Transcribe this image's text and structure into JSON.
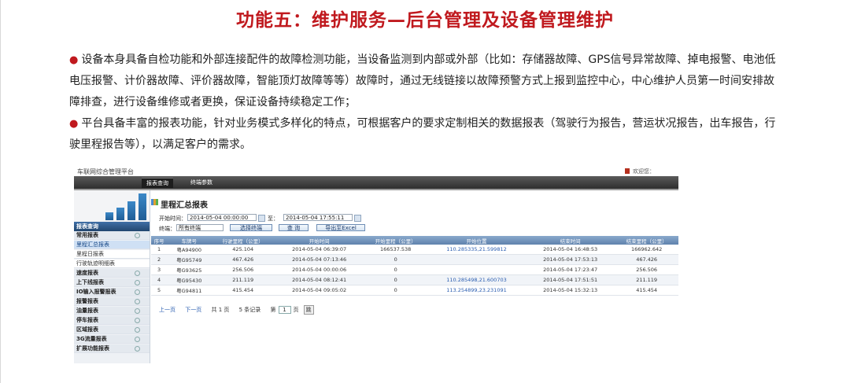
{
  "slide": {
    "title": "功能五：维护服务—后台管理及设备管理维护",
    "bullet_mark": "●",
    "bullets": [
      "设备本身具备自检功能和外部连接配件的故障检测功能，当设备监测到内部或外部（比如：存储器故障、GPS信号异常故障、掉电报警、电池低电压报警、计价器故障、评价器故障，智能顶灯故障等等）故障时，通过无线链接以故障预警方式上报到监控中心，中心维护人员第一时间安排故障排查，进行设备维修或者更换，保证设备持续稳定工作；",
      "平台具备丰富的报表功能，针对业务模式多样化的特点，可根据客户的要求定制相关的数据报表（驾驶行为报告，营运状况报告，出车报告，行驶里程报告等），以满足客户的需求。"
    ]
  },
  "app": {
    "title": "车联网综合管理平台",
    "user_text": "欢迎您：",
    "nav_tabs": [
      "报表查询",
      "终端参数"
    ],
    "sidebar": {
      "header": "报表查询",
      "items": [
        {
          "label": "常用报表",
          "kind": "group"
        },
        {
          "label": "里程汇总报表",
          "kind": "selected"
        },
        {
          "label": "里程日报表",
          "kind": "sub"
        },
        {
          "label": "行驶轨迹明细表",
          "kind": "sub"
        },
        {
          "label": "速度报表",
          "kind": "group"
        },
        {
          "label": "上下线报表",
          "kind": "group"
        },
        {
          "label": "IO输入报警报表",
          "kind": "group"
        },
        {
          "label": "报警报表",
          "kind": "group"
        },
        {
          "label": "油量报表",
          "kind": "group"
        },
        {
          "label": "停车报表",
          "kind": "group"
        },
        {
          "label": "区域报表",
          "kind": "group"
        },
        {
          "label": "3G流量报表",
          "kind": "group"
        },
        {
          "label": "扩展功能报表",
          "kind": "group"
        }
      ]
    },
    "report": {
      "title": "里程汇总报表",
      "start_label": "开始时间：",
      "start_value": "2014-05-04 00:00:00",
      "to_label": "至：",
      "end_value": "2014-05-04 17:55:11",
      "terminal_label": "终端：",
      "terminal_value": "所有终端",
      "select_btn": "选择终端",
      "query_btn": "查 询",
      "export_btn": "导出至Excel",
      "columns": [
        "序号",
        "车牌号",
        "行驶里程（公里）",
        "开始时间",
        "开始里程（公里）",
        "开始位置",
        "结束时间",
        "结束里程（公里）"
      ],
      "rows": [
        [
          "1",
          "粤A94900",
          "425.104",
          "2014-05-04 06:39:07",
          "166537.538",
          "110.285335,21.599812",
          "2014-05-04 16:48:53",
          "166962.642"
        ],
        [
          "2",
          "粤G95749",
          "467.426",
          "2014-05-04 07:13:46",
          "0",
          "",
          "2014-05-04 17:53:13",
          "467.426"
        ],
        [
          "3",
          "粤G93625",
          "256.506",
          "2014-05-04 00:00:06",
          "0",
          "",
          "2014-05-04 17:23:47",
          "256.506"
        ],
        [
          "4",
          "粤G95430",
          "211.119",
          "2014-05-04 08:12:41",
          "0",
          "110.285498,21.600703",
          "2014-05-04 17:51:51",
          "211.119"
        ],
        [
          "5",
          "粤G94811",
          "415.454",
          "2014-05-04 09:05:02",
          "0",
          "113.254899,23.231091",
          "2014-05-04 15:32:13",
          "415.454"
        ]
      ],
      "pager": {
        "prev": "上一页",
        "next": "下一页",
        "total": "共 1 页",
        "records": "5 条记录",
        "page_label_pre": "第",
        "page_value": "1",
        "page_label_post": "页",
        "go": "跳"
      }
    }
  }
}
